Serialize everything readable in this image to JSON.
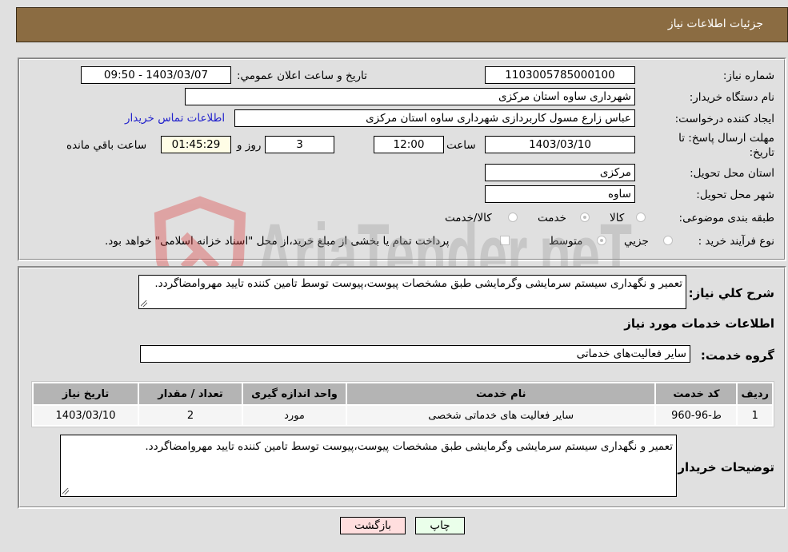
{
  "header": {
    "title": "جزئيات اطلاعات نياز"
  },
  "info": {
    "need_number_label": "شماره نياز:",
    "need_number": "1103005785000100",
    "announce_label": "تاريخ و ساعت اعلان عمومي:",
    "announce_value": "1403/03/07 - 09:50",
    "buyer_org_label": "نام دستگاه خريدار:",
    "buyer_org": "شهرداری ساوه استان مرکزی",
    "creator_label": "ايجاد کننده درخواست:",
    "creator": "عباس زارع مسول کاربردازی شهرداری ساوه استان مرکزی",
    "contact_link": "اطلاعات تماس خريدار",
    "deadline_label_line1": "مهلت ارسال پاسخ: تا",
    "deadline_label_line2": "تاريخ:",
    "deadline_date": "1403/03/10",
    "time_label": "ساعت",
    "deadline_time": "12:00",
    "days_value": "3",
    "days_label": "روز و",
    "remaining_value": "01:45:29",
    "remaining_label": "ساعت باقي مانده",
    "province_label": "استان محل تحويل:",
    "province": "مرکزی",
    "city_label": "شهر محل تحويل:",
    "city": "ساوه",
    "category_label": "طبقه بندی موضوعی:",
    "category_options": [
      {
        "label": "کالا",
        "selected": false
      },
      {
        "label": "خدمت",
        "selected": true
      },
      {
        "label": "کالا/خدمت",
        "selected": false
      }
    ],
    "process_label": "نوع فرآيند خريد :",
    "process_options": [
      {
        "label": "جزيي",
        "selected": false
      },
      {
        "label": "متوسط",
        "selected": true
      }
    ],
    "treasury_checkbox_label": "پرداخت تمام يا بخشی از مبلغ خريد،از محل \"اسناد خزانه اسلامی\" خواهد بود.",
    "treasury_checked": false
  },
  "description": {
    "label": "شرح کلي نياز:",
    "text": "تعمير و نگهداری سيستم سرمايشی وگرمايشی طبق مشخصات پيوست،پيوست توسط تامين کننده تاييد مهروامضاگردد."
  },
  "services": {
    "section_title": "اطلاعات خدمات مورد نياز",
    "group_label": "گروه خدمت:",
    "group_value": "ساير فعاليت‌های خدماتی",
    "columns": [
      "رديف",
      "کد خدمت",
      "نام خدمت",
      "واحد اندازه گيری",
      "تعداد / مقدار",
      "تاريخ نياز"
    ],
    "rows": [
      [
        "1",
        "ط-96-960",
        "ساير فعاليت های خدماتی شخصی",
        "مورد",
        "2",
        "1403/03/10"
      ]
    ]
  },
  "buyer_notes": {
    "label": "توضيحات خريدار:",
    "text": "تعمير و نگهداری سيستم سرمايشی وگرمايشی طبق مشخصات پيوست،پيوست توسط تامين کننده تاييد مهروامضاگردد."
  },
  "buttons": {
    "print": "چاپ",
    "back": "بازگشت"
  },
  "colors": {
    "header_bg": "#8b6c42",
    "print_bg": "#eaffea",
    "back_bg": "#ffdede",
    "link": "#2222cc"
  },
  "watermark": {
    "text": "AriaTender.neT"
  }
}
